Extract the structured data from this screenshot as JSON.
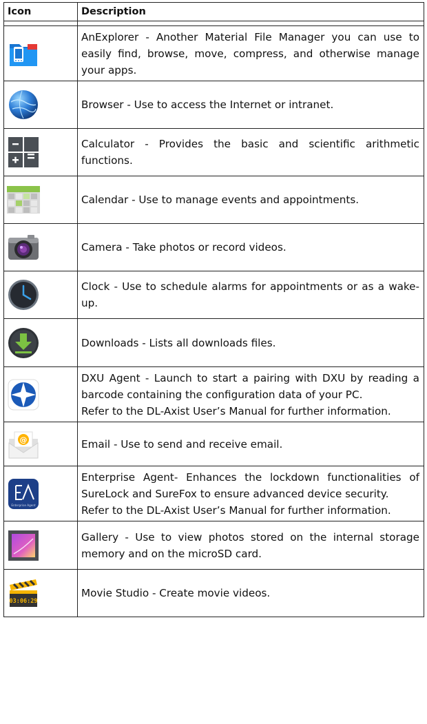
{
  "header": {
    "icon_col": "Icon",
    "desc_col": "Description"
  },
  "rows": [
    {
      "icon": "folder-phone-icon",
      "text": "AnExplorer - Another Material File Manager you can use to easily find, browse, move, compress, and otherwise manage your apps."
    },
    {
      "icon": "globe-icon",
      "text": "Browser - Use to access the Internet or intranet."
    },
    {
      "icon": "calculator-icon",
      "text": "Calculator - Provides the basic and scientific arithmetic functions."
    },
    {
      "icon": "calendar-icon",
      "text": "Calendar - Use to manage events and appointments."
    },
    {
      "icon": "camera-icon",
      "text": "Camera - Take photos or record videos."
    },
    {
      "icon": "clock-icon",
      "text": "Clock - Use to schedule alarms for appointments or as a wake-up."
    },
    {
      "icon": "download-icon",
      "text": "Downloads - Lists all downloads files."
    },
    {
      "icon": "compass-star-icon",
      "text": "DXU Agent - Launch to start a pairing with DXU by reading a barcode containing the configuration data of your PC.",
      "text2": "Refer to the DL-Axist User’s Manual for further information."
    },
    {
      "icon": "email-envelope-icon",
      "text": "Email - Use to send and receive email."
    },
    {
      "icon": "enterprise-agent-icon",
      "icon_label": "Enterprise Agent",
      "text": "Enterprise Agent- Enhances the lockdown functionalities of SureLock and SureFox to ensure advanced device security.",
      "text2": "Refer to the DL-Axist User’s Manual for further information."
    },
    {
      "icon": "gallery-icon",
      "text": "Gallery - Use to view photos stored on the internal storage memory and on the microSD card."
    },
    {
      "icon": "clapperboard-icon",
      "icon_label": "03:06:29",
      "text": "Movie Studio - Create movie videos."
    }
  ]
}
